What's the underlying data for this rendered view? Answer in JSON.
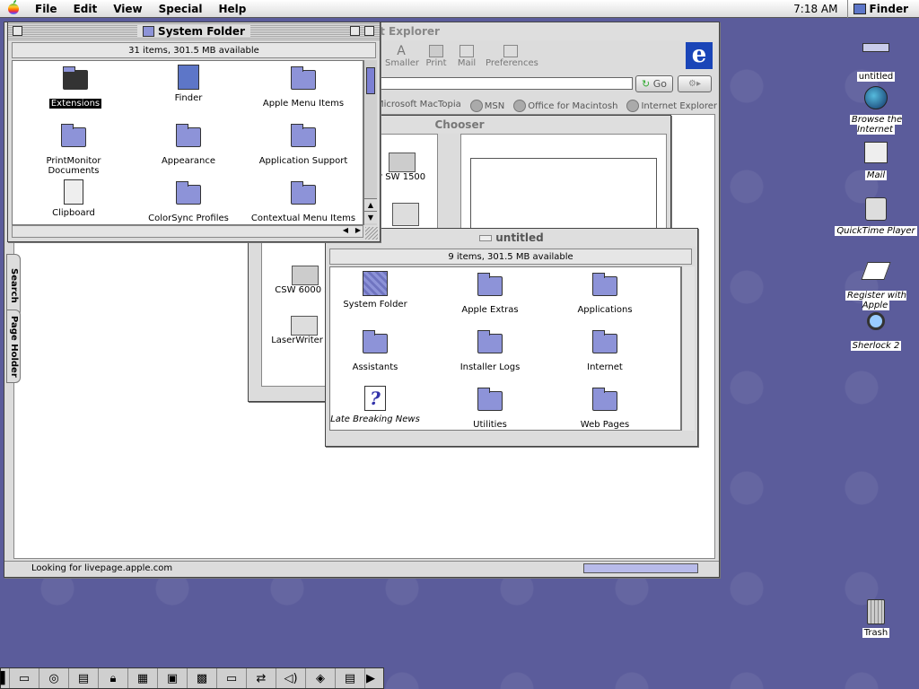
{
  "menubar": {
    "apple": "",
    "items": [
      "File",
      "Edit",
      "View",
      "Special",
      "Help"
    ],
    "clock": "7:18 AM",
    "app": "Finder"
  },
  "ie": {
    "title": "et Explorer",
    "toolbar": [
      "Smaller",
      "Print",
      "Mail",
      "Preferences"
    ],
    "go": "Go",
    "favorites": [
      "Microsoft MacTopia",
      "MSN",
      "Office for Macintosh",
      "Internet Explorer"
    ],
    "tabs": [
      "Search",
      "Page Holder"
    ],
    "status": "Looking for livepage.apple.com"
  },
  "chooser": {
    "title": "Chooser",
    "printers": [
      "r SW 1500",
      "CSW 6000 Se",
      "LaserWriter 30"
    ]
  },
  "system_folder": {
    "title": "System Folder",
    "info": "31 items, 301.5 MB available",
    "items": [
      "Extensions",
      "Finder",
      "Apple Menu Items",
      "PrintMonitor Documents",
      "Appearance",
      "Application Support",
      "Clipboard",
      "ColorSync Profiles",
      "Contextual Menu Items"
    ]
  },
  "untitled": {
    "title": "untitled",
    "info": "9 items, 301.5 MB available",
    "items": [
      "System Folder",
      "Apple Extras",
      "Applications",
      "Assistants",
      "Installer Logs",
      "Internet",
      "Late Breaking News",
      "Utilities",
      "Web Pages"
    ]
  },
  "desktop": {
    "icons": [
      "untitled",
      "Browse the Internet",
      "Mail",
      "QuickTime Player",
      "Register with Apple",
      "Sherlock 2",
      "Trash"
    ]
  },
  "colors": {
    "desktop": "#5b5c9b",
    "folder": "#8d93d8",
    "selection": "#000000"
  }
}
